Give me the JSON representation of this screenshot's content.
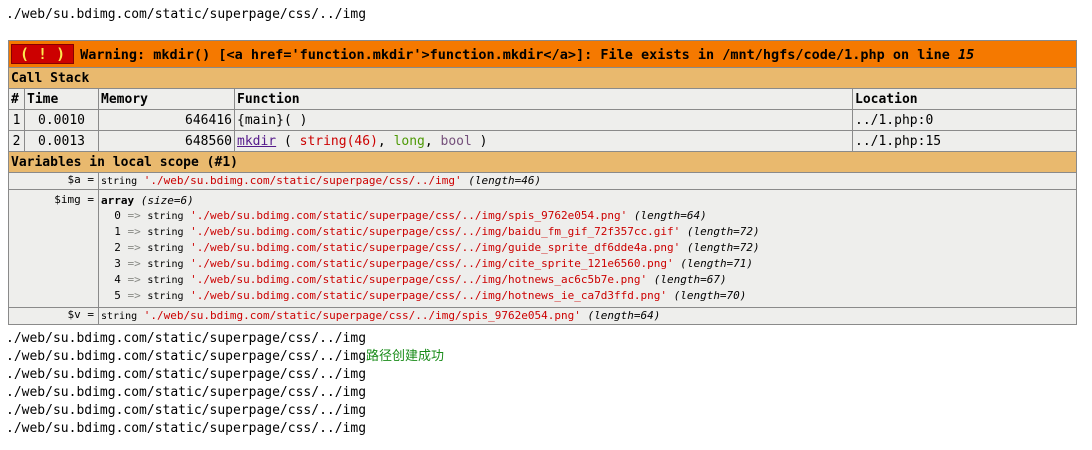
{
  "top_path": "./web/su.bdimg.com/static/superpage/css/../img",
  "warning": {
    "badge": "( ! )",
    "message": "Warning: mkdir() [<a href='function.mkdir'>function.mkdir</a>]: File exists in /mnt/hgfs/code/1.php on line ",
    "line": "15"
  },
  "call_stack": {
    "title": "Call Stack",
    "columns": [
      "#",
      "Time",
      "Memory",
      "Function",
      "Location"
    ],
    "rows": [
      {
        "num": "1",
        "time": "0.0010",
        "memory": "646416",
        "func": "{main}( )",
        "location": "../1.php:0"
      },
      {
        "num": "2",
        "time": "0.0013",
        "memory": "648560",
        "func_name": "mkdir",
        "func_open": " ( ",
        "arg1": "string(46)",
        "sep1": ", ",
        "arg2": "long",
        "sep2": ", ",
        "arg3": "bool",
        "func_close": " )",
        "location": "../1.php:15"
      }
    ]
  },
  "vars": {
    "title": "Variables in local scope (#1)",
    "a": {
      "name": "$a =",
      "type": "string",
      "value": "'./web/su.bdimg.com/static/superpage/css/../img'",
      "length": "(length=46)"
    },
    "img": {
      "name": "$img =",
      "type": "array",
      "size": "(size=6)",
      "items": [
        {
          "index": "0",
          "arrow": "=>",
          "type": "string",
          "value": "'./web/su.bdimg.com/static/superpage/css/../img/spis_9762e054.png'",
          "length": "(length=64)"
        },
        {
          "index": "1",
          "arrow": "=>",
          "type": "string",
          "value": "'./web/su.bdimg.com/static/superpage/css/../img/baidu_fm_gif_72f357cc.gif'",
          "length": "(length=72)"
        },
        {
          "index": "2",
          "arrow": "=>",
          "type": "string",
          "value": "'./web/su.bdimg.com/static/superpage/css/../img/guide_sprite_df6dde4a.png'",
          "length": "(length=72)"
        },
        {
          "index": "3",
          "arrow": "=>",
          "type": "string",
          "value": "'./web/su.bdimg.com/static/superpage/css/../img/cite_sprite_121e6560.png'",
          "length": "(length=71)"
        },
        {
          "index": "4",
          "arrow": "=>",
          "type": "string",
          "value": "'./web/su.bdimg.com/static/superpage/css/../img/hotnews_ac6c5b7e.png'",
          "length": "(length=67)"
        },
        {
          "index": "5",
          "arrow": "=>",
          "type": "string",
          "value": "'./web/su.bdimg.com/static/superpage/css/../img/hotnews_ie_ca7d3ffd.png'",
          "length": "(length=70)"
        }
      ]
    },
    "v": {
      "name": "$v =",
      "type": "string",
      "value": "'./web/su.bdimg.com/static/superpage/css/../img/spis_9762e054.png'",
      "length": "(length=64)"
    }
  },
  "output_lines": [
    "./web/su.bdimg.com/static/superpage/css/../img",
    "./web/su.bdimg.com/static/superpage/css/../img",
    "./web/su.bdimg.com/static/superpage/css/../img",
    "./web/su.bdimg.com/static/superpage/css/../img",
    "./web/su.bdimg.com/static/superpage/css/../img",
    "./web/su.bdimg.com/static/superpage/css/../img"
  ],
  "success_text": "路径创建成功"
}
